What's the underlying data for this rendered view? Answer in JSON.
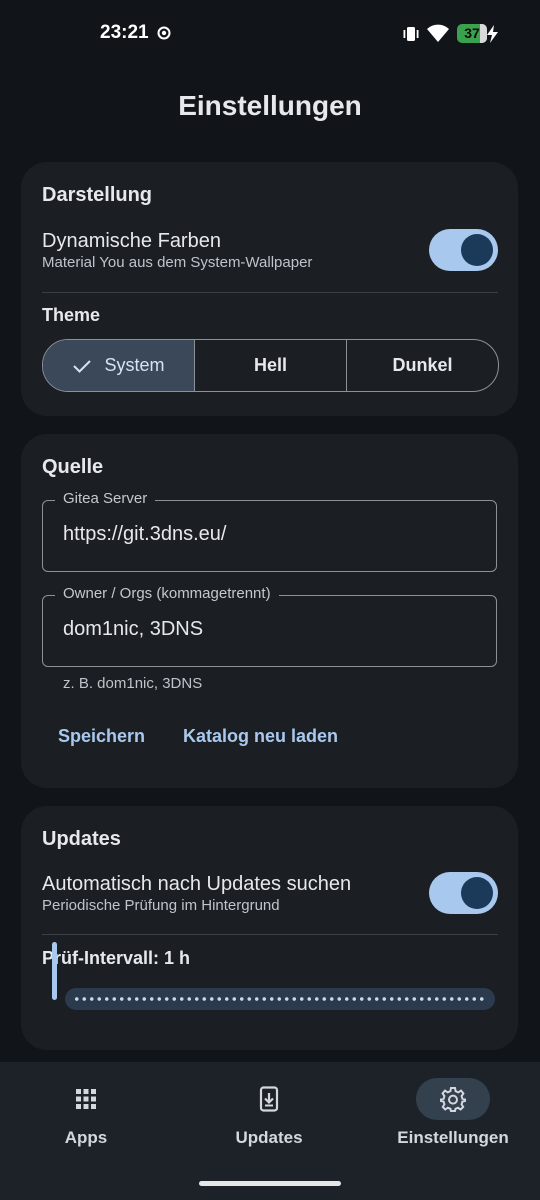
{
  "status_bar": {
    "time": "23:21",
    "battery": "37"
  },
  "page": {
    "title": "Einstellungen"
  },
  "darstellung": {
    "title": "Darstellung",
    "dynamic_colors_label": "Dynamische Farben",
    "dynamic_colors_sub": "Material You aus dem System-Wallpaper",
    "dynamic_colors_on": true,
    "theme_label": "Theme",
    "theme_options": [
      "System",
      "Hell",
      "Dunkel"
    ],
    "theme_selected": "System"
  },
  "quelle": {
    "title": "Quelle",
    "server_label": "Gitea Server",
    "server_value": "https://git.3dns.eu/",
    "owners_label": "Owner / Orgs (kommagetrennt)",
    "owners_value": "dom1nic, 3DNS",
    "owners_helper": "z. B. dom1nic, 3DNS",
    "save_label": "Speichern",
    "reload_label": "Katalog neu laden"
  },
  "updates": {
    "title": "Updates",
    "auto_check_label": "Automatisch nach Updates suchen",
    "auto_check_sub": "Periodische Prüfung im Hintergrund",
    "auto_check_on": true,
    "interval_label": "Prüf-Intervall: 1 h",
    "interval_fraction": 0
  },
  "nav": {
    "items": [
      {
        "label": "Apps",
        "icon": "grid-icon"
      },
      {
        "label": "Updates",
        "icon": "download-icon"
      },
      {
        "label": "Einstellungen",
        "icon": "gear-icon"
      }
    ],
    "active": "Einstellungen"
  },
  "colors": {
    "background": "#111418",
    "card": "#1b1f24",
    "accent": "#a8c8ee",
    "selected_segment": "#3a4859"
  }
}
